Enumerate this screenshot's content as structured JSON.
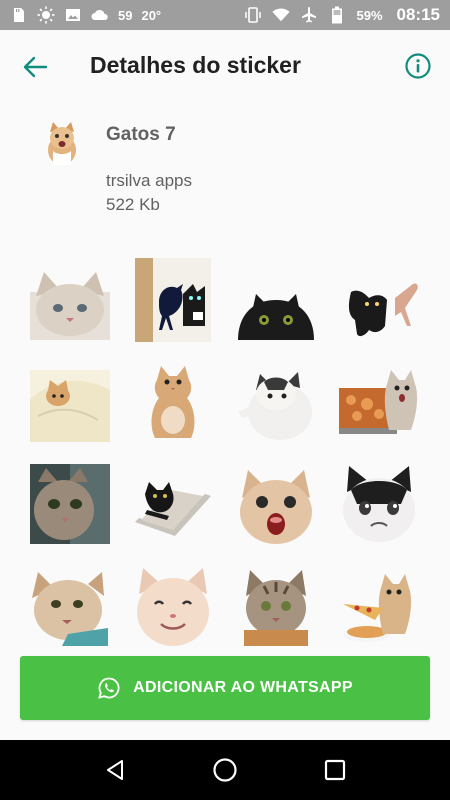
{
  "status_bar": {
    "notification_count": "59",
    "temperature": "20°",
    "battery": "59%",
    "time": "08:15"
  },
  "app_bar": {
    "title": "Detalhes do sticker"
  },
  "pack": {
    "name": "Gatos 7",
    "author": "trsilva apps",
    "size": "522 Kb"
  },
  "stickers": [
    {
      "icon": "cat-sticker-1"
    },
    {
      "icon": "cat-crow-sticker"
    },
    {
      "icon": "black-cat-sticker"
    },
    {
      "icon": "black-cat-hands-sticker"
    },
    {
      "icon": "cat-in-bed-sticker"
    },
    {
      "icon": "sitting-cat-sticker"
    },
    {
      "icon": "chubby-cat-sticker"
    },
    {
      "icon": "cat-pizza-tray-sticker"
    },
    {
      "icon": "cat-selfie-sticker"
    },
    {
      "icon": "cat-laptop-sticker"
    },
    {
      "icon": "screaming-cat-sticker"
    },
    {
      "icon": "crying-cat-sticker"
    },
    {
      "icon": "grumpy-cat-sticker"
    },
    {
      "icon": "smiling-cat-sticker"
    },
    {
      "icon": "tabby-cat-sticker"
    },
    {
      "icon": "cat-pizza-sticker"
    }
  ],
  "add_button": {
    "label": "ADICIONAR AO WHATSAPP"
  },
  "colors": {
    "accent": "#128c7e",
    "button": "#4ac144",
    "status_bar": "#9e9e9e"
  }
}
